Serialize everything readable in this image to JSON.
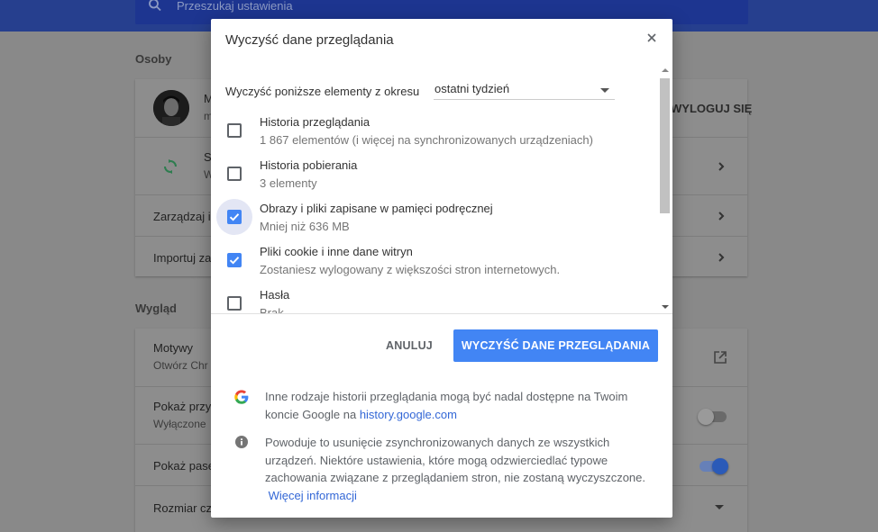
{
  "background": {
    "search_placeholder": "Przeszukaj ustawienia",
    "sections": {
      "people": "Osoby",
      "appearance": "Wygląd"
    },
    "people_card": {
      "profile_name_partial": "M",
      "profile_sub_partial": "m",
      "signout_label": "WYLOGUJ SIĘ",
      "sync_title_partial": "S",
      "sync_sub_partial": "W",
      "manage_partial": "Zarządzaj i",
      "import_partial": "Importuj za"
    },
    "appearance_card": {
      "themes_title": "Motywy",
      "themes_sub_partial": "Otwórz Chr",
      "home_button_partial": "Pokaż przy",
      "home_button_sub_partial": "Wyłączone",
      "bookmarks_bar_partial": "Pokaż pase",
      "font_size_partial": "Rozmiar cz"
    },
    "colors": {
      "accent": "#4285f4",
      "topbar": "#263f8e"
    }
  },
  "dialog": {
    "title": "Wyczyść dane przeglądania",
    "period_label": "Wyczyść poniższe elementy z okresu",
    "period_value": "ostatni tydzień",
    "items": [
      {
        "title": "Historia przeglądania",
        "sub": "1 867 elementów (i więcej na synchronizowanych urządzeniach)",
        "checked": false
      },
      {
        "title": "Historia pobierania",
        "sub": "3 elementy",
        "checked": false
      },
      {
        "title": "Obrazy i pliki zapisane w pamięci podręcznej",
        "sub": "Mniej niż 636 MB",
        "checked": true
      },
      {
        "title": "Pliki cookie i inne dane witryn",
        "sub": "Zostaniesz wylogowany z większości stron internetowych.",
        "checked": true
      },
      {
        "title": "Hasła",
        "sub": "Brak",
        "checked": false
      }
    ],
    "cancel_label": "ANULUJ",
    "clear_label": "WYCZYŚĆ DANE PRZEGLĄDANIA",
    "info_google_text": "Inne rodzaje historii przeglądania mogą być nadal dostępne na Twoim koncie Google na",
    "info_google_link": "history.google.com",
    "info_sync_text": "Powoduje to usunięcie zsynchronizowanych danych ze wszystkich urządzeń. Niektóre ustawienia, które mogą odzwierciedlać typowe zachowania związane z przeglądaniem stron, nie zostaną wyczyszczone.",
    "info_sync_link": "Więcej informacji"
  }
}
